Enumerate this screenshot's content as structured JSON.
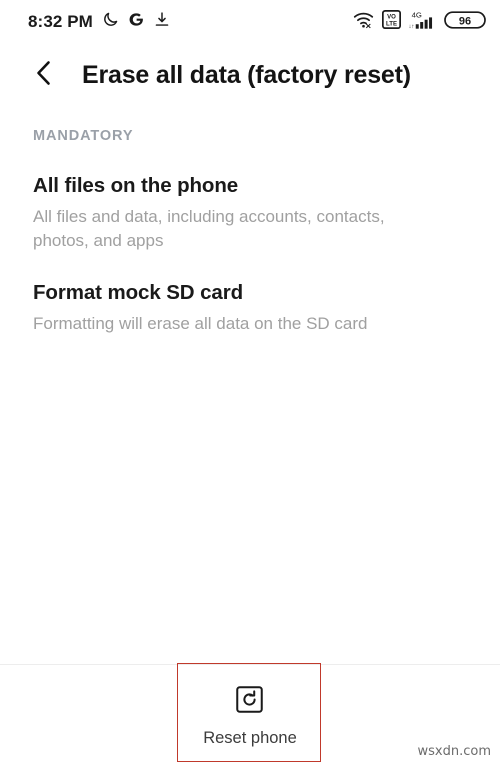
{
  "statusbar": {
    "time": "8:32 PM",
    "left_icons": [
      {
        "name": "dnd-moon-icon",
        "glyph": "moon"
      },
      {
        "name": "google-g-icon",
        "glyph": "G"
      },
      {
        "name": "download-icon",
        "glyph": "download"
      }
    ],
    "right_icons": [
      {
        "name": "wifi-icon",
        "glyph": "wifi"
      },
      {
        "name": "volte-icon",
        "glyph": "VoLTE"
      },
      {
        "name": "cellular-signal-icon",
        "glyph": "4G-bars",
        "network": "4G"
      }
    ],
    "battery_percent": "96"
  },
  "appbar": {
    "back_icon": "back-chevron-icon",
    "title": "Erase all data (factory reset)"
  },
  "content": {
    "section_label": "MANDATORY",
    "items": [
      {
        "title": "All files on the phone",
        "subtitle": "All files and data, including accounts, contacts, photos, and apps"
      },
      {
        "title": "Format mock SD card",
        "subtitle": "Formatting will erase all data on the SD card"
      }
    ]
  },
  "bottom_bar": {
    "reset_icon": "reset-phone-icon",
    "reset_label": "Reset phone"
  },
  "annotation": {
    "highlight_color": "#c0392b"
  },
  "watermark": {
    "text": "wsxdn.com"
  }
}
